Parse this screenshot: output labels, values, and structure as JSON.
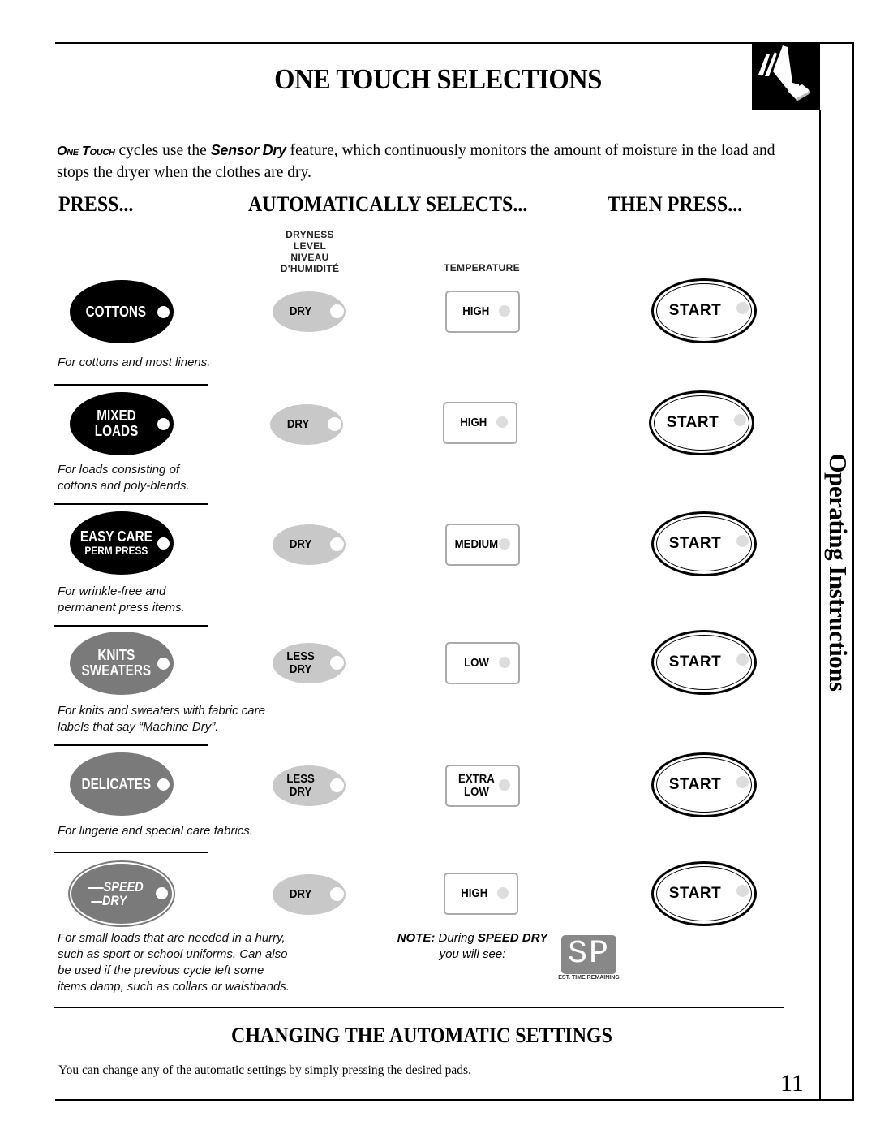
{
  "page": {
    "title": "ONE TOUCH SELECTIONS",
    "side_tab": "Operating Instructions",
    "page_number": "11",
    "corner_icon": "finger-pressing-pad-icon"
  },
  "intro": {
    "term1": "One Touch",
    "text1": " cycles use the ",
    "term2": "Sensor Dry",
    "text2": " feature, which continuously monitors the amount of moisture in the load and stops the dryer when the clothes are dry."
  },
  "columns": {
    "press": "PRESS...",
    "auto_selects": "AUTOMATICALLY SELECTS...",
    "then_press": "THEN PRESS..."
  },
  "subheaders": {
    "dryness_line1": "DRYNESS",
    "dryness_line2": "LEVEL",
    "dryness_line3": "NIVEAU",
    "dryness_line4": "D'HUMIDITÉ",
    "temperature": "TEMPERATURE"
  },
  "cycles": [
    {
      "label1": "COTTONS",
      "label2": "",
      "style": "dark",
      "dryness1": "DRY",
      "dryness2": "",
      "temp1": "HIGH",
      "temp2": "",
      "start": "START",
      "description": "For cottons and most linens."
    },
    {
      "label1": "MIXED",
      "label2": "LOADS",
      "style": "dark",
      "dryness1": "DRY",
      "dryness2": "",
      "temp1": "HIGH",
      "temp2": "",
      "start": "START",
      "description": "For loads consisting of\ncottons and poly-blends."
    },
    {
      "label1": "EASY CARE",
      "label2": "PERM PRESS",
      "style": "dark",
      "dryness1": "DRY",
      "dryness2": "",
      "temp1": "MEDIUM",
      "temp2": "",
      "start": "START",
      "description": "For wrinkle-free and\npermanent press items."
    },
    {
      "label1": "KNITS",
      "label2": "SWEATERS",
      "style": "grey",
      "dryness1": "LESS",
      "dryness2": "DRY",
      "temp1": "LOW",
      "temp2": "",
      "start": "START",
      "description": "For knits and sweaters with fabric care\nlabels that say “Machine Dry”."
    },
    {
      "label1": "DELICATES",
      "label2": "",
      "style": "grey",
      "dryness1": "LESS",
      "dryness2": "DRY",
      "temp1": "EXTRA",
      "temp2": "LOW",
      "start": "START",
      "description": "For lingerie and special care fabrics."
    },
    {
      "label1": "SPEED",
      "label2": "DRY",
      "style": "speed",
      "dryness1": "DRY",
      "dryness2": "",
      "temp1": "HIGH",
      "temp2": "",
      "start": "START",
      "description": "For small loads that are needed in a hurry,\nsuch as sport or school uniforms. Can also\nbe used if the previous cycle left some\nitems damp, such as collars or waistbands."
    }
  ],
  "note": {
    "prefix": "NOTE:",
    "text1": " During ",
    "emph": "SPEED DRY",
    "line2": "you will see:",
    "display": "SP",
    "display_caption": "EST. TIME REMAINING"
  },
  "changing": {
    "heading": "CHANGING THE AUTOMATIC SETTINGS",
    "body": "You can change any of the automatic settings by simply pressing the desired pads."
  }
}
